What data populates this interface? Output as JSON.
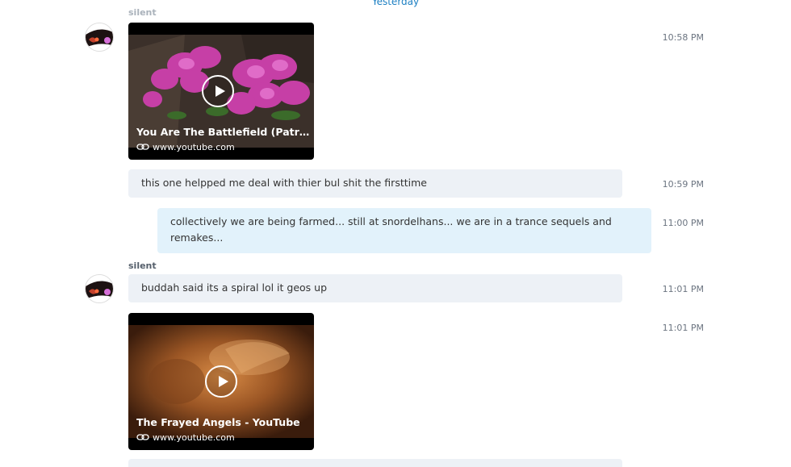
{
  "day_divider": "Yesterday",
  "sender": "silent",
  "messages": [
    {
      "type": "video",
      "title": "You Are The Battlefield (Patrick...",
      "link": "www.youtube.com",
      "time": "10:58 PM"
    },
    {
      "type": "text",
      "text": "this one helpped me deal with thier bul shit the firsttime",
      "time": "10:59 PM"
    },
    {
      "type": "text",
      "direction": "outgoing",
      "text_line1": "collectively we are being farmed... still at snordelhans...  we are in a trance sequels and",
      "text_line2": "remakes...",
      "time": "11:00 PM"
    },
    {
      "type": "text",
      "text": "buddah said its a spiral lol  it geos up",
      "time": "11:01 PM"
    },
    {
      "type": "video",
      "title": "The Frayed Angels - YouTube",
      "link": "www.youtube.com",
      "time": "11:01 PM"
    }
  ],
  "colors": {
    "incoming_bubble": "#edf1f6",
    "outgoing_bubble": "#e2f2fb",
    "accent": "#1a7ec2"
  },
  "icons": [
    "avatar",
    "play-icon",
    "link-icon"
  ]
}
